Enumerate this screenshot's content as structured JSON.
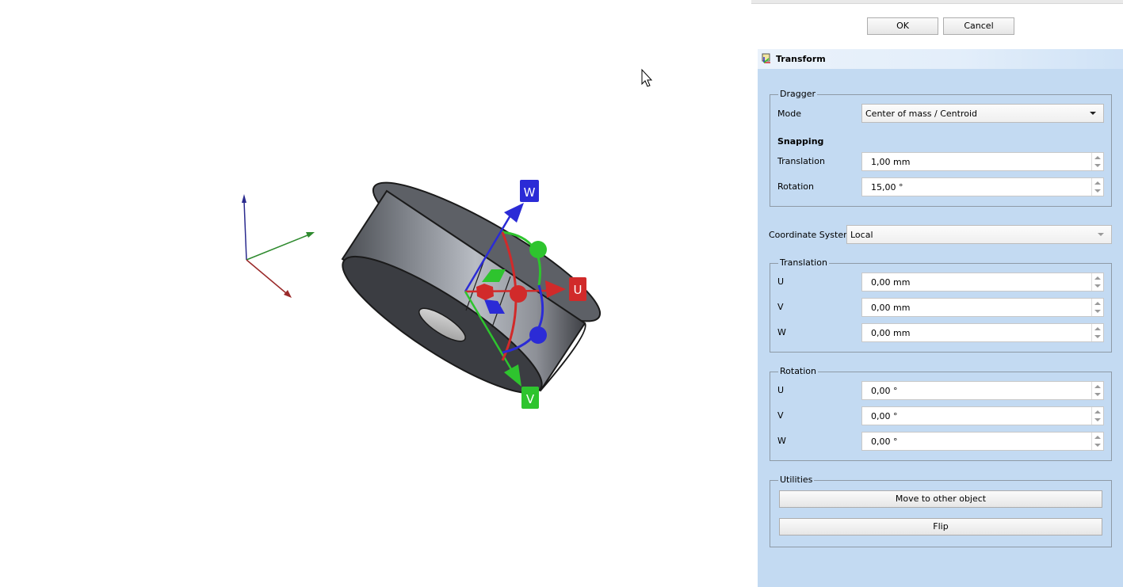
{
  "dialog": {
    "ok_label": "OK",
    "cancel_label": "Cancel"
  },
  "taskbox": {
    "title": "Transform"
  },
  "dragger": {
    "group_label": "Dragger",
    "mode_label": "Mode",
    "mode_value": "Center of mass / Centroid",
    "snapping_label": "Snapping",
    "translation_label": "Translation",
    "translation_value": "1,00 mm",
    "rotation_label": "Rotation",
    "rotation_value": "15,00 °"
  },
  "coordinate_system": {
    "label": "Coordinate System",
    "value": "Local"
  },
  "translation": {
    "group_label": "Translation",
    "u_label": "U",
    "u_value": "0,00 mm",
    "v_label": "V",
    "v_value": "0,00 mm",
    "w_label": "W",
    "w_value": "0,00 mm"
  },
  "rotation": {
    "group_label": "Rotation",
    "u_label": "U",
    "u_value": "0,00 °",
    "v_label": "V",
    "v_value": "0,00 °",
    "w_label": "W",
    "w_value": "0,00 °"
  },
  "utilities": {
    "group_label": "Utilities",
    "move_label": "Move to other object",
    "flip_label": "Flip"
  },
  "viewport": {
    "gizmo_labels": {
      "u": "U",
      "v": "V",
      "w": "W"
    },
    "colors": {
      "u_axis": "#d12a2a",
      "v_axis": "#2ec42e",
      "w_axis": "#2b2bd6",
      "panel_bg": "#c3daf2"
    }
  }
}
